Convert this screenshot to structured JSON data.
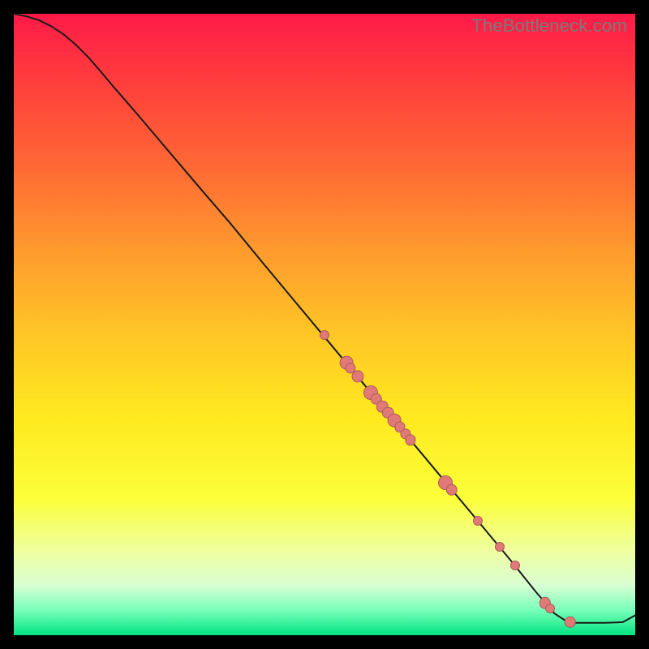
{
  "watermark": "TheBottleneck.com",
  "chart_data": {
    "type": "line",
    "title": "",
    "xlabel": "",
    "ylabel": "",
    "xlim": [
      0,
      100
    ],
    "ylim": [
      0,
      100
    ],
    "curve": [
      {
        "x": 0,
        "y": 100
      },
      {
        "x": 2,
        "y": 99.6
      },
      {
        "x": 4,
        "y": 99.0
      },
      {
        "x": 6,
        "y": 98.0
      },
      {
        "x": 8,
        "y": 96.7
      },
      {
        "x": 10,
        "y": 95.0
      },
      {
        "x": 12,
        "y": 93.0
      },
      {
        "x": 14,
        "y": 90.7
      },
      {
        "x": 16,
        "y": 88.3
      },
      {
        "x": 18,
        "y": 86.0
      },
      {
        "x": 20,
        "y": 83.7
      },
      {
        "x": 25,
        "y": 77.8
      },
      {
        "x": 30,
        "y": 71.9
      },
      {
        "x": 35,
        "y": 66.1
      },
      {
        "x": 40,
        "y": 60.0
      },
      {
        "x": 45,
        "y": 54.0
      },
      {
        "x": 50,
        "y": 48.0
      },
      {
        "x": 55,
        "y": 42.0
      },
      {
        "x": 60,
        "y": 36.0
      },
      {
        "x": 65,
        "y": 30.0
      },
      {
        "x": 70,
        "y": 24.0
      },
      {
        "x": 75,
        "y": 18.0
      },
      {
        "x": 80,
        "y": 12.0
      },
      {
        "x": 84,
        "y": 7.0
      },
      {
        "x": 87,
        "y": 3.5
      },
      {
        "x": 89,
        "y": 2.2
      },
      {
        "x": 90,
        "y": 2.0
      },
      {
        "x": 92,
        "y": 2.0
      },
      {
        "x": 95,
        "y": 2.0
      },
      {
        "x": 98,
        "y": 2.1
      },
      {
        "x": 100,
        "y": 3.2
      }
    ],
    "markers": [
      {
        "x": 50.0,
        "y": 48.3,
        "size": 1.0
      },
      {
        "x": 53.5,
        "y": 43.8,
        "size": 1.8
      },
      {
        "x": 54.2,
        "y": 43.0,
        "size": 1.2
      },
      {
        "x": 55.3,
        "y": 41.7,
        "size": 1.5
      },
      {
        "x": 57.5,
        "y": 39.0,
        "size": 2.0
      },
      {
        "x": 58.3,
        "y": 38.0,
        "size": 1.4
      },
      {
        "x": 59.3,
        "y": 36.8,
        "size": 1.4
      },
      {
        "x": 60.2,
        "y": 35.8,
        "size": 1.4
      },
      {
        "x": 61.2,
        "y": 34.6,
        "size": 1.8
      },
      {
        "x": 62.1,
        "y": 33.5,
        "size": 1.2
      },
      {
        "x": 63.0,
        "y": 32.4,
        "size": 1.2
      },
      {
        "x": 63.8,
        "y": 31.4,
        "size": 1.2
      },
      {
        "x": 69.5,
        "y": 24.6,
        "size": 2.0
      },
      {
        "x": 70.5,
        "y": 23.4,
        "size": 1.4
      },
      {
        "x": 74.7,
        "y": 18.4,
        "size": 1.0
      },
      {
        "x": 78.2,
        "y": 14.2,
        "size": 1.0
      },
      {
        "x": 80.7,
        "y": 11.2,
        "size": 1.0
      },
      {
        "x": 85.5,
        "y": 5.2,
        "size": 1.4
      },
      {
        "x": 86.3,
        "y": 4.3,
        "size": 1.0
      },
      {
        "x": 89.5,
        "y": 2.1,
        "size": 1.4
      }
    ]
  }
}
